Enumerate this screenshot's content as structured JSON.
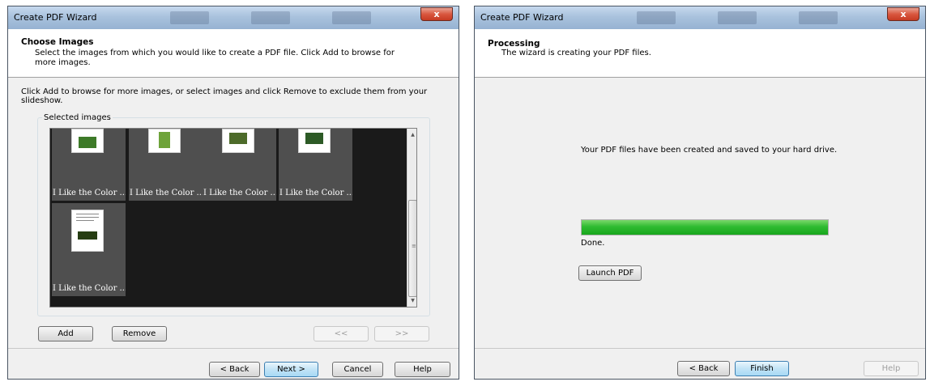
{
  "left_window": {
    "title": "Create PDF Wizard",
    "close_label": "x",
    "header_title": "Choose Images",
    "header_subtitle": "Select the images from which you would like to create a PDF file. Click Add to browse for more images.",
    "instruction": "Click Add to browse for more images, or select images and click Remove to exclude them from your slideshow.",
    "group_label": "Selected images",
    "images": [
      {
        "caption": "I Like the Color ..."
      },
      {
        "caption": "I Like the Color ..."
      },
      {
        "caption": "I Like the Color ..."
      },
      {
        "caption": "I Like the Color ..."
      },
      {
        "caption": "I Like the Color ..."
      }
    ],
    "buttons": {
      "add": "Add",
      "remove": "Remove",
      "prev": "<<",
      "next_page": ">>",
      "back": "< Back",
      "next": "Next >",
      "cancel": "Cancel",
      "help": "Help"
    }
  },
  "right_window": {
    "title": "Create PDF Wizard",
    "close_label": "x",
    "header_title": "Processing",
    "header_subtitle": "The wizard is creating your PDF files.",
    "message": "Your PDF files have been created and saved to your hard drive.",
    "progress_percent": 100,
    "progress_status": "Done.",
    "buttons": {
      "launch": "Launch PDF",
      "back": "< Back",
      "finish": "Finish",
      "help": "Help"
    }
  }
}
